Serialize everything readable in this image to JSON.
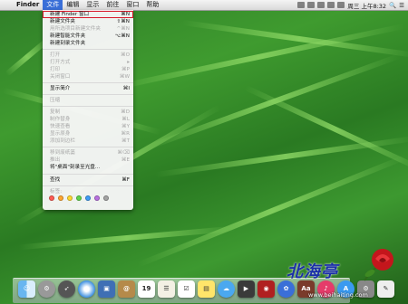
{
  "menubar": {
    "app_name": "Finder",
    "menus": [
      "文件",
      "编辑",
      "显示",
      "前往",
      "窗口",
      "帮助"
    ],
    "clock": "周三 上午8:32"
  },
  "file_menu": {
    "items": [
      {
        "label": "新建 Finder 窗口",
        "shortcut": "⌘N",
        "enabled": true,
        "highlighted": true
      },
      {
        "label": "新建文件夹",
        "shortcut": "⇧⌘N",
        "enabled": true
      },
      {
        "label": "用所选项目新建文件夹",
        "shortcut": "^⌘N",
        "enabled": false
      },
      {
        "label": "新建智能文件夹",
        "shortcut": "⌥⌘N",
        "enabled": true
      },
      {
        "label": "新建刻录文件夹",
        "shortcut": "",
        "enabled": true
      },
      {
        "label": "打开",
        "shortcut": "⌘O",
        "enabled": false
      },
      {
        "label": "打开方式",
        "shortcut": "▸",
        "enabled": false
      },
      {
        "label": "打印",
        "shortcut": "⌘P",
        "enabled": false
      },
      {
        "label": "关闭窗口",
        "shortcut": "⌘W",
        "enabled": false
      },
      {
        "label": "显示简介",
        "shortcut": "⌘I",
        "enabled": true
      },
      {
        "label": "压缩",
        "shortcut": "",
        "enabled": false
      },
      {
        "label": "复制",
        "shortcut": "⌘D",
        "enabled": false
      },
      {
        "label": "制作替身",
        "shortcut": "⌘L",
        "enabled": false
      },
      {
        "label": "快速查看",
        "shortcut": "⌘Y",
        "enabled": false
      },
      {
        "label": "显示原身",
        "shortcut": "⌘R",
        "enabled": false
      },
      {
        "label": "添加到边栏",
        "shortcut": "⌘T",
        "enabled": false
      },
      {
        "label": "移到废纸篓",
        "shortcut": "⌘⌫",
        "enabled": false
      },
      {
        "label": "推出",
        "shortcut": "⌘E",
        "enabled": false
      },
      {
        "label": "将\"桌面\"刻录至光盘...",
        "shortcut": "",
        "enabled": true
      },
      {
        "label": "查找",
        "shortcut": "⌘F",
        "enabled": true
      },
      {
        "label": "标签:",
        "shortcut": "",
        "enabled": false
      }
    ],
    "tag_colors": [
      "#ff5a52",
      "#ffa530",
      "#ffd830",
      "#5fd34c",
      "#3d9bf5",
      "#b870e0",
      "#a3a3a3"
    ]
  },
  "dock": {
    "icons": [
      "finder-icon",
      "launchpad-icon",
      "rocket-icon",
      "safari-icon",
      "preview-icon",
      "contacts-icon",
      "calendar-icon",
      "notes-icon",
      "reminders-icon",
      "stickies-icon",
      "messages-icon",
      "facetime-icon",
      "photo-booth-icon",
      "photos-icon",
      "dictionary-icon",
      "music-icon",
      "app-store-icon",
      "system-preferences-icon",
      "textedit-icon"
    ],
    "calendar_day": "19"
  },
  "watermark": {
    "title": "北海亭",
    "url": "www.beihaiting.com"
  }
}
